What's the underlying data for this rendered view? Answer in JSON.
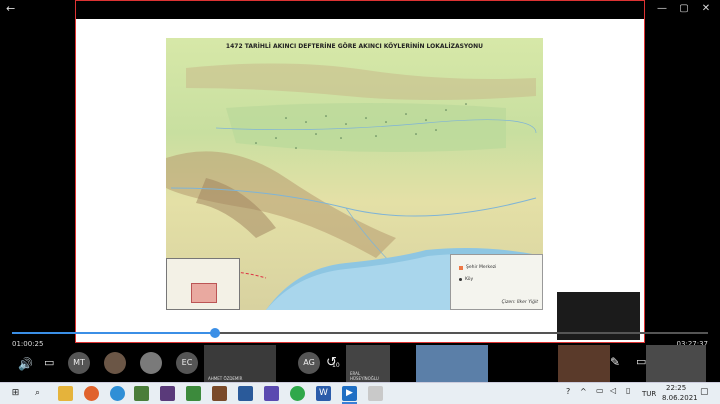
{
  "window": {
    "back_glyph": "←",
    "minimize_glyph": "—",
    "maximize_glyph": "▢",
    "close_glyph": "✕"
  },
  "map": {
    "title": "1472 TARİHLİ AKINCI DEFTERİNE GÖRE AKINCI KÖYLERİNİN LOKALİZASYONU",
    "legend": {
      "item1": "Şehir Merkezi",
      "item2": "Köy",
      "credit": "Çizen: İlker Yiğit"
    }
  },
  "player": {
    "elapsed": "01:00:25",
    "total": "03:27:37",
    "progress": 0.291,
    "volume_icon": "🔊",
    "skip_back_label": "10",
    "skip_forward_label": "30"
  },
  "participants": {
    "p1_initials": "MT",
    "p2_initials": "EC",
    "p3_initials": "AG",
    "v1_label": "AHMET ÖZDEMİR",
    "v2_label": "ERAL HÜSEYİNOĞLU"
  },
  "taskbar": {
    "language": "TUR",
    "time": "22:25",
    "date": "8.06.2021"
  }
}
